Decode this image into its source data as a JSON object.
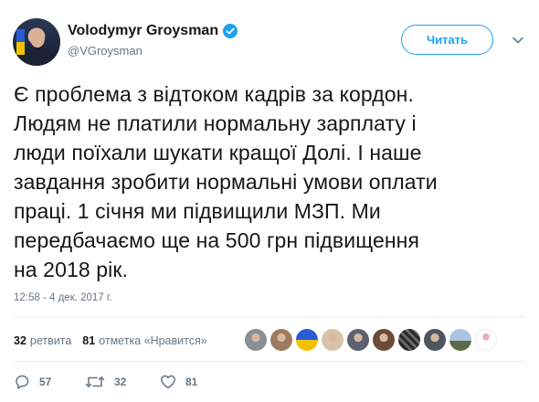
{
  "author": {
    "name": "Volodymyr Groysman",
    "handle": "@VGroysman",
    "verified": true
  },
  "follow_button": {
    "label": "Читать"
  },
  "tweet": {
    "lines": [
      "Є проблема з відтоком кадрів за кордон.",
      "Людям не платили нормальну зарплату і",
      "люди поїхали шукати кращої Долі. І наше",
      "завдання зробити нормальні умови оплати",
      "праці. 1 січня ми підвищили МЗП. Ми",
      "передбачаємо ще на 500 грн підвищення",
      "на 2018 рік."
    ],
    "timestamp": "12:58 - 4 дек. 2017 г."
  },
  "stats": {
    "retweets_count": "32",
    "retweets_label": "ретвита",
    "likes_count": "81",
    "likes_label": "отметка «Нравится»"
  },
  "likers": [
    {
      "icon": "avatar-portrait",
      "color": "#8a8f96"
    },
    {
      "icon": "avatar-portrait",
      "color": "#9c7b5f"
    },
    {
      "icon": "avatar-flag",
      "color": "#f2c200"
    },
    {
      "icon": "avatar-portrait",
      "color": "#d9c3a8"
    },
    {
      "icon": "avatar-portrait",
      "color": "#5a6270"
    },
    {
      "icon": "avatar-portrait",
      "color": "#6b4a3a"
    },
    {
      "icon": "avatar-pattern",
      "color": "#3a3a3a"
    },
    {
      "icon": "avatar-portrait",
      "color": "#4d5560"
    },
    {
      "icon": "avatar-landscape",
      "color": "#6f8fb0"
    },
    {
      "icon": "avatar-figure",
      "color": "#ffffff"
    }
  ],
  "actions": {
    "replies": "57",
    "retweets": "32",
    "likes": "81"
  },
  "colors": {
    "accent": "#1da1f2",
    "text": "#14171a",
    "secondary": "#657786",
    "divider": "#e6ecf0"
  }
}
